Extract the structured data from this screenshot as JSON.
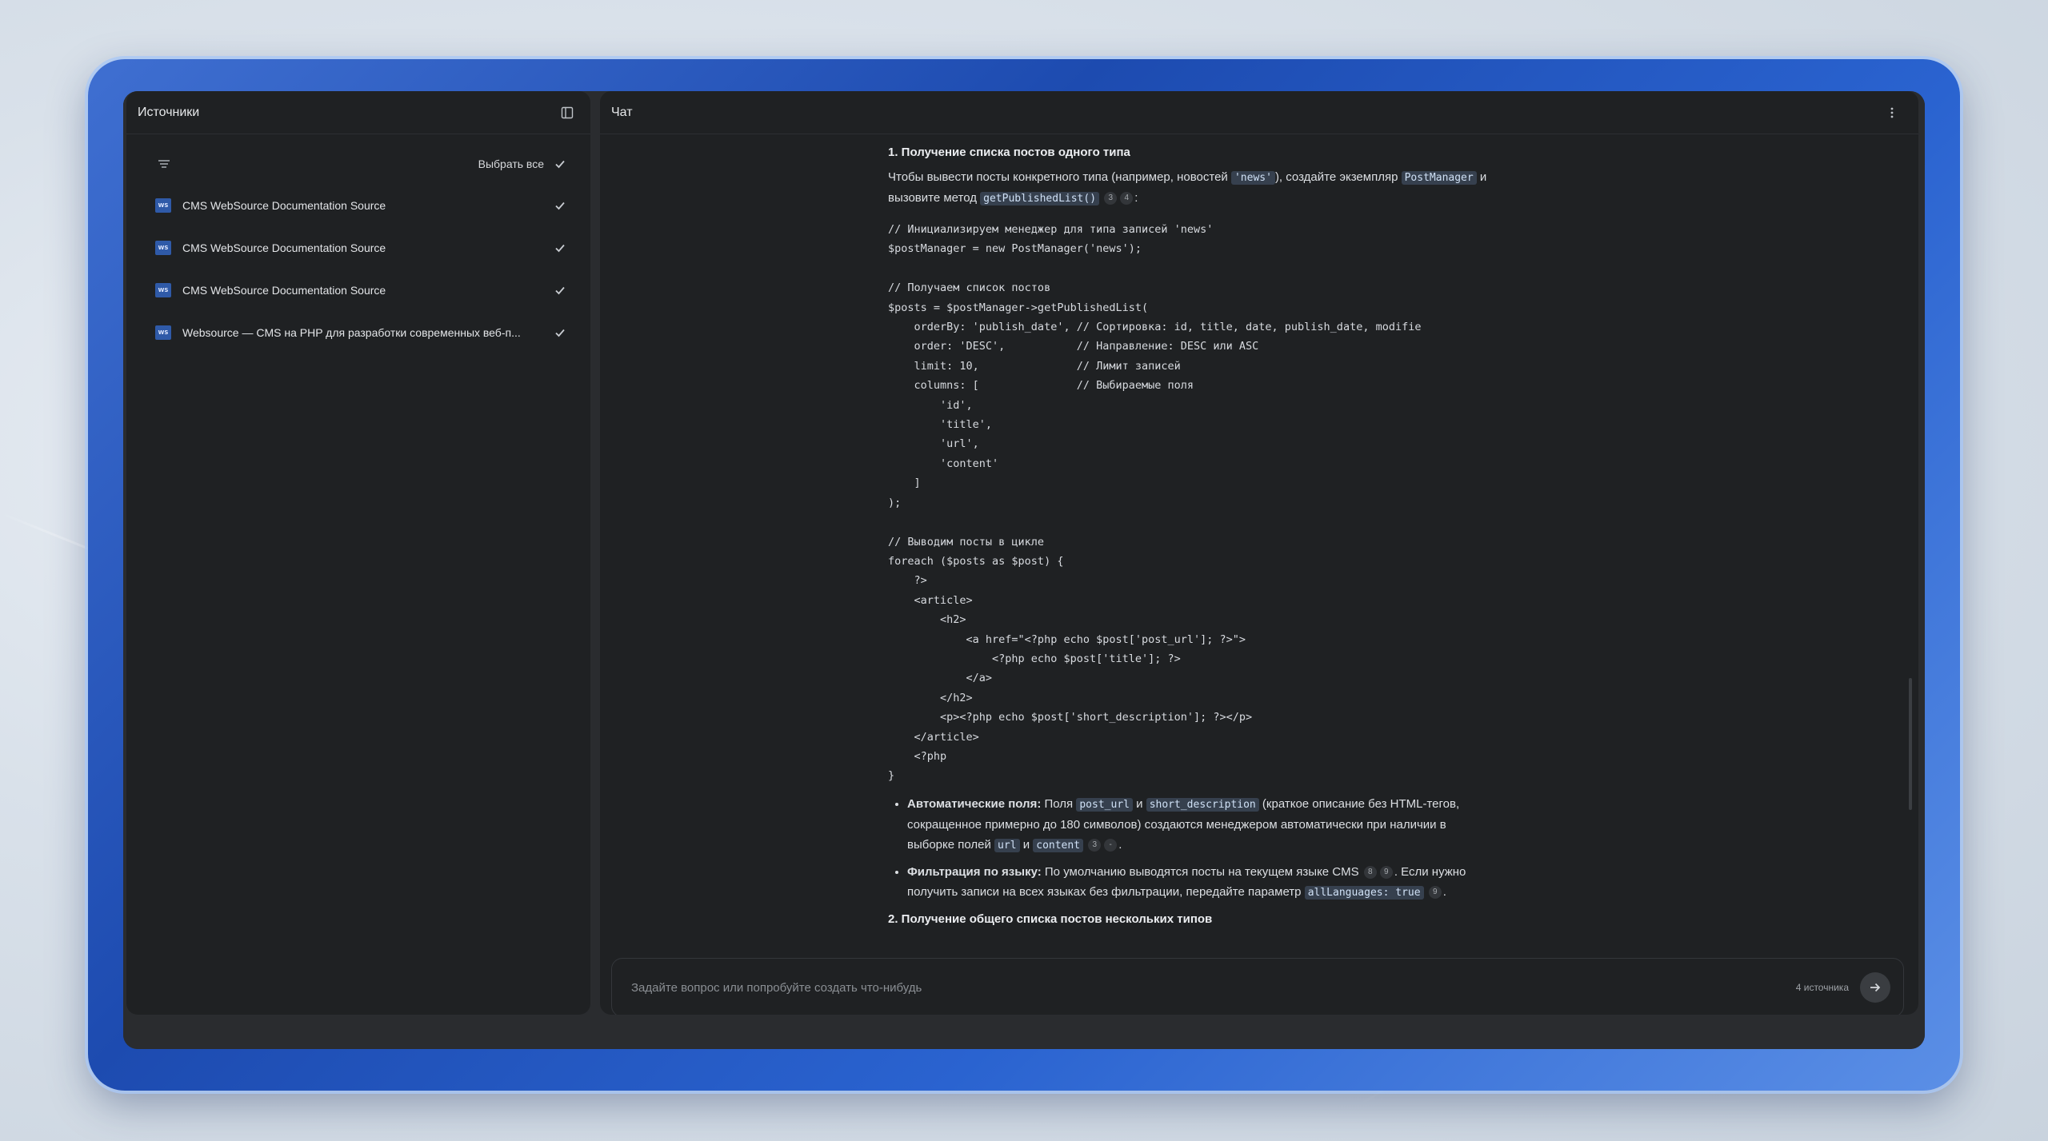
{
  "sources_panel": {
    "title": "Источники",
    "select_all_label": "Выбрать все",
    "items": [
      {
        "label": "CMS WebSource Documentation Source"
      },
      {
        "label": "CMS WebSource Documentation Source"
      },
      {
        "label": "CMS WebSource Documentation Source"
      },
      {
        "label": "Websource — CMS на PHP для разработки современных веб-п..."
      }
    ],
    "favicon_text": "WS"
  },
  "chat_panel": {
    "title": "Чат",
    "section1_title": "1. Получение списка постов одного типа",
    "intro_part1": "Чтобы вывести посты конкретного типа (например, новостей ",
    "intro_code1": "'news'",
    "intro_part2": "), создайте экземпляр ",
    "intro_code2": "PostManager",
    "intro_part3": " и вызовите метод ",
    "intro_code3": "getPublishedList()",
    "intro_cite1": "3",
    "intro_cite2": "4",
    "intro_end": ":",
    "code_block": "// Инициализируем менеджер для типа записей 'news'\n$postManager = new PostManager('news');\n\n// Получаем список постов\n$posts = $postManager->getPublishedList(\n    orderBy: 'publish_date', // Сортировка: id, title, date, publish_date, modifie\n    order: 'DESC',           // Направление: DESC или ASC\n    limit: 10,               // Лимит записей\n    columns: [               // Выбираемые поля\n        'id',\n        'title',\n        'url',\n        'content'\n    ]\n);\n\n// Выводим посты в цикле\nforeach ($posts as $post) {\n    ?>\n    <article>\n        <h2>\n            <a href=\"<?php echo $post['post_url']; ?>\">\n                <?php echo $post['title']; ?>\n            </a>\n        </h2>\n        <p><?php echo $post['short_description']; ?></p>\n    </article>\n    <?php\n}",
    "bullet1_bold": "Автоматические поля:",
    "bullet1_t1": " Поля ",
    "bullet1_c1": "post_url",
    "bullet1_t2": " и ",
    "bullet1_c2": "short_description",
    "bullet1_t3": " (краткое описание без HTML-тегов, сокращенное примерно до 180 символов) создаются менеджером автоматически при наличии в выборке полей ",
    "bullet1_c3": "url",
    "bullet1_t4": " и ",
    "bullet1_c4": "content",
    "bullet1_cite1": "3",
    "bullet1_cite2": "-",
    "bullet1_end": ".",
    "bullet2_bold": "Фильтрация по языку:",
    "bullet2_t1": " По умолчанию выводятся посты на текущем языке CMS ",
    "bullet2_cite1": "8",
    "bullet2_cite2": "9",
    "bullet2_t2": ". Если нужно получить записи на всех языках без фильтрации, передайте параметр ",
    "bullet2_c1": "allLanguages: true",
    "bullet2_cite3": "9",
    "bullet2_end": ".",
    "section2_title": "2. Получение общего списка постов нескольких типов",
    "composer_placeholder": "Задайте вопрос или попробуйте создать что-нибудь",
    "sources_count": "4 источника"
  },
  "icons": [
    "filter-icon",
    "panel-toggle-icon",
    "check-icon",
    "more-vertical-icon",
    "chevron-down-icon",
    "arrow-right-icon"
  ]
}
